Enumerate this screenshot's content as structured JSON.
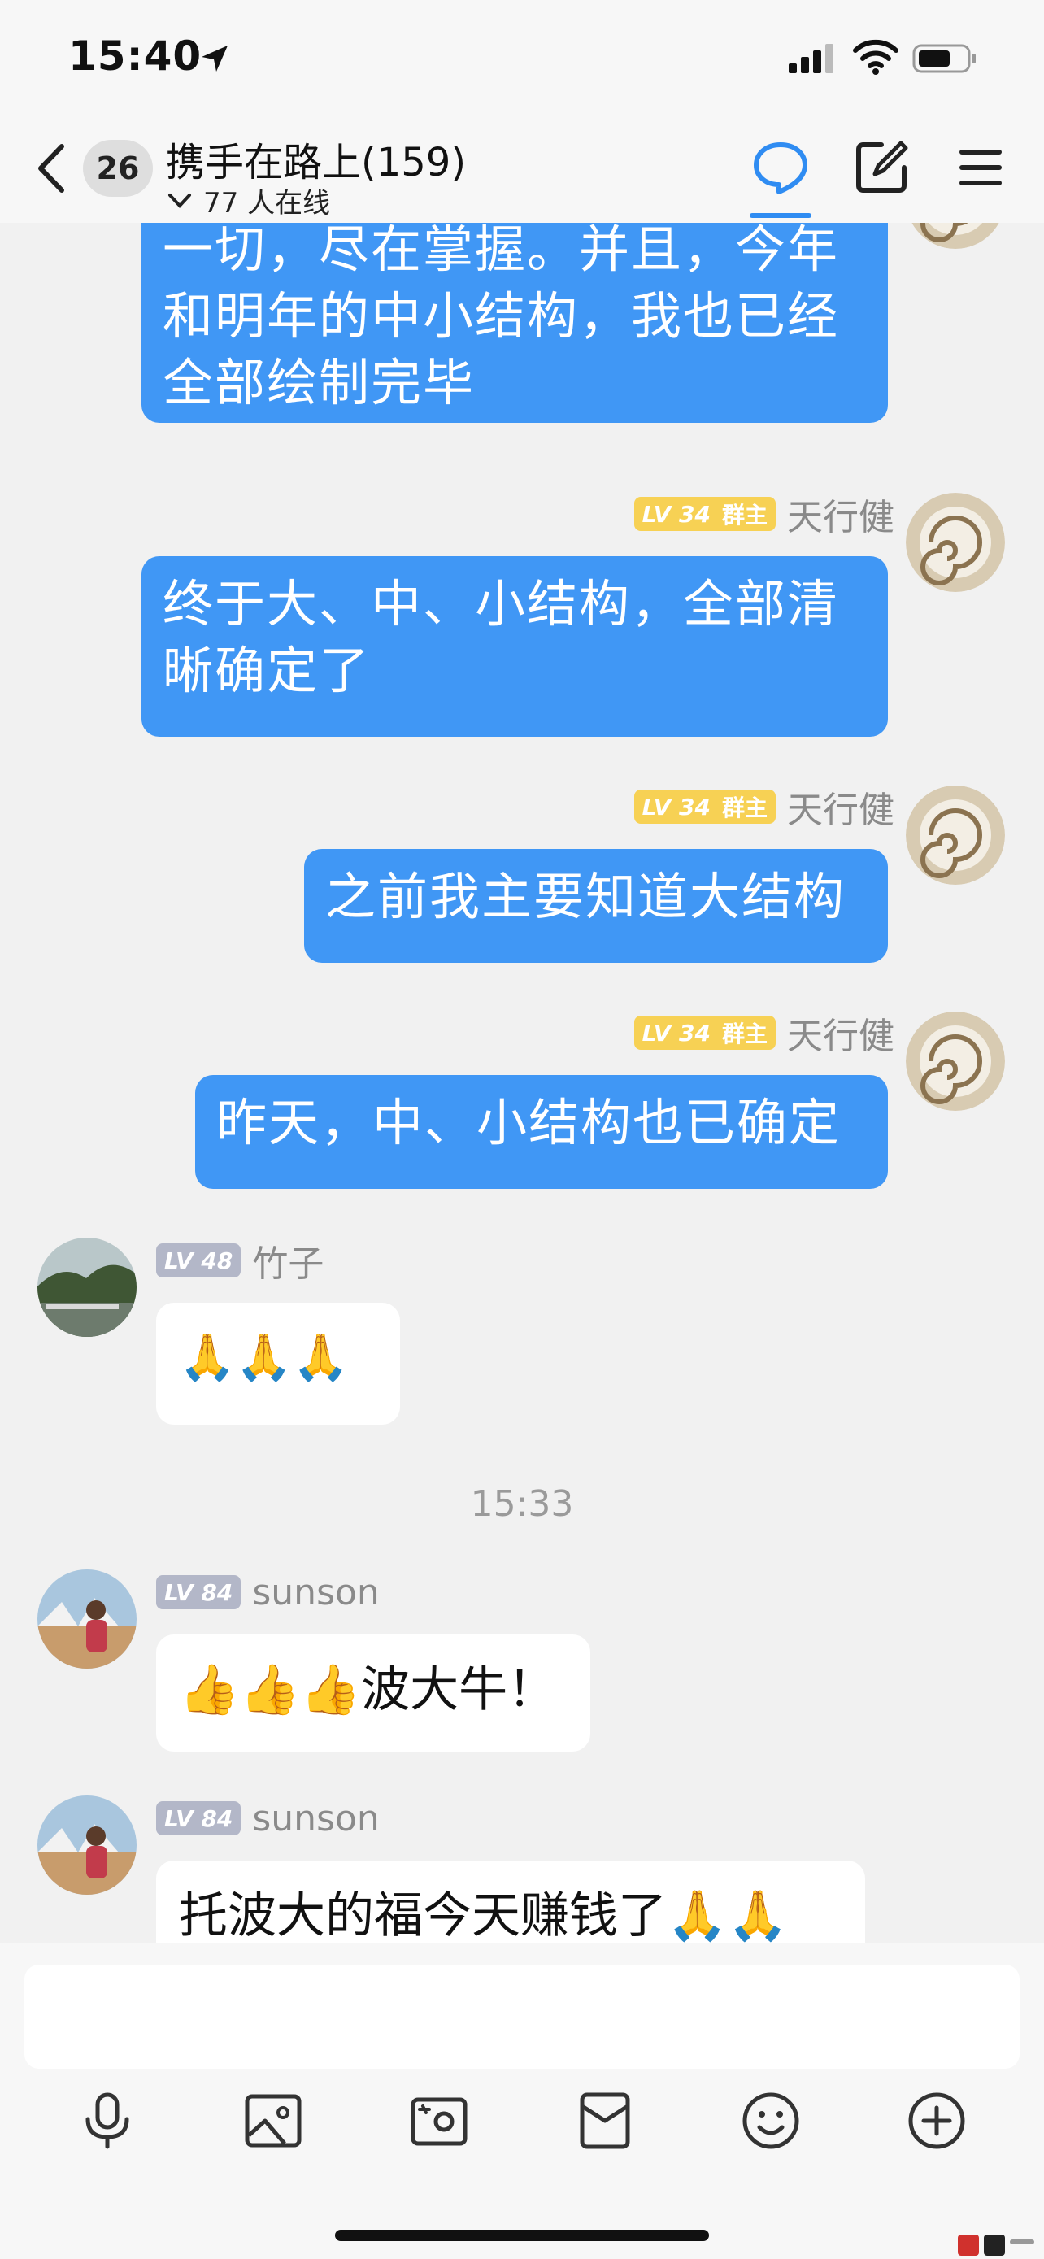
{
  "status_bar": {
    "time": "15:40"
  },
  "header": {
    "unread_count": "26",
    "title": "携手在路上(159)",
    "online_text": "77 人在线"
  },
  "messages": [
    {
      "text": "一切，尽在掌握。并且，今年\n和明年的中小结构，我也已经\n全部绘制完毕"
    },
    {
      "level": "LV 34",
      "role": "群主",
      "sender": "天行健",
      "text": "终于大、中、小结构，全部清\n晰确定了"
    },
    {
      "level": "LV 34",
      "role": "群主",
      "sender": "天行健",
      "text": "之前我主要知道大结构"
    },
    {
      "level": "LV 34",
      "role": "群主",
      "sender": "天行健",
      "text": "昨天，中、小结构也已确定"
    },
    {
      "level": "LV 48",
      "sender": "竹子",
      "text": "🙏🙏🙏"
    },
    {
      "level": "LV 84",
      "sender": "sunson",
      "text": "👍👍👍波大牛！"
    },
    {
      "level": "LV 84",
      "sender": "sunson",
      "text": "托波大的福今天赚钱了🙏🙏"
    }
  ],
  "time_divider": "15:33",
  "colors": {
    "accent": "#2f8cf2",
    "self_bubble": "#4097f5",
    "owner_badge": "#f7d154",
    "member_badge": "#b3b7c8",
    "background": "#f1f1f1"
  },
  "toolbar_icons": [
    "microphone-icon",
    "image-icon",
    "camera-icon",
    "red-packet-icon",
    "emoji-icon",
    "plus-icon"
  ]
}
